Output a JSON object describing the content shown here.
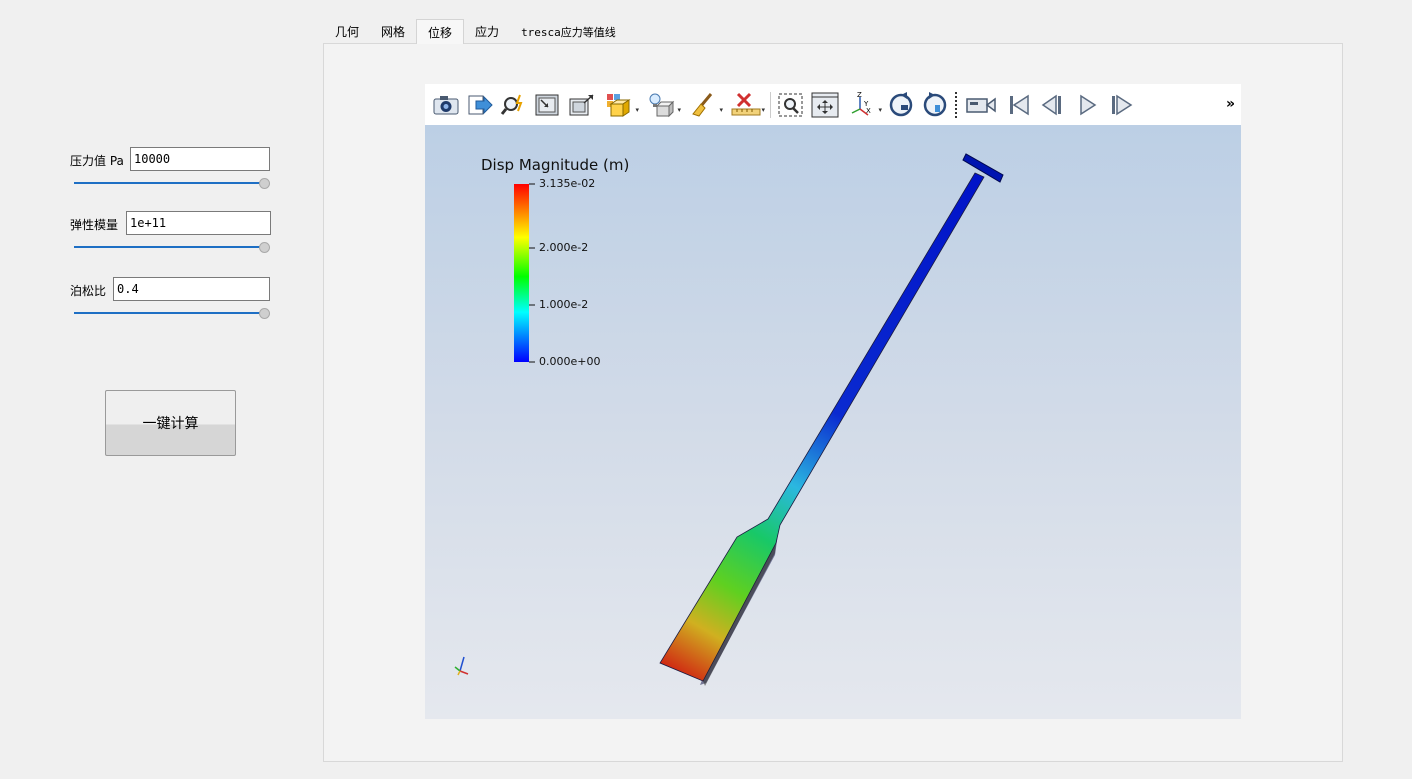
{
  "left_panel": {
    "pressure_label": "压力值 Pa",
    "pressure_value": "10000",
    "pressure_level": 1.0,
    "modulus_label": "弹性模量",
    "modulus_value": "1e+11",
    "modulus_level": 1.0,
    "poisson_label": "泊松比",
    "poisson_value": "0.4",
    "poisson_level": 1.0,
    "calc_button": "一键计算"
  },
  "tabs": [
    {
      "label": "几何",
      "active": false
    },
    {
      "label": "网格",
      "active": false
    },
    {
      "label": "位移",
      "active": true
    },
    {
      "label": "应力",
      "active": false
    },
    {
      "label": "tresca应力等值线",
      "active": false
    }
  ],
  "toolbar": {
    "icons": [
      "camera-icon",
      "export-icon",
      "pick-zoom-icon",
      "reset-camera-icon",
      "zoom-to-data-icon",
      "box-selection-icon",
      "light-icon",
      "clear-icon",
      "ruler-icon",
      "zoom-box-icon",
      "fit-icon",
      "axes-orient-icon",
      "rotate-cw-icon",
      "rotate-ccw-icon",
      "video-camera-icon",
      "first-frame-icon",
      "prev-frame-icon",
      "play-icon",
      "last-frame-icon"
    ],
    "more": "»"
  },
  "viewport": {
    "colorbar_title": "Disp Magnitude (m)",
    "colorbar_ticks": [
      "3.135e-02",
      "2.000e-2",
      "1.000e-2",
      "0.000e+00"
    ],
    "colormap": [
      "#ff0000",
      "#ffff00",
      "#00ff00",
      "#00ffff",
      "#0000ff"
    ],
    "axis_labels": [
      "Z",
      "Y",
      "X"
    ]
  }
}
